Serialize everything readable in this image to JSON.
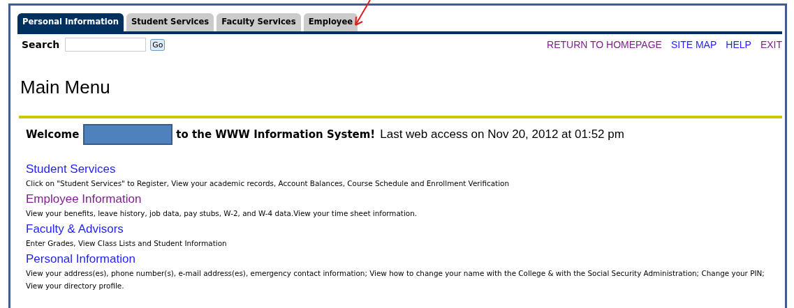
{
  "tabs": [
    {
      "label": "Personal Information",
      "selected": true
    },
    {
      "label": "Student Services",
      "selected": false
    },
    {
      "label": "Faculty Services",
      "selected": false
    },
    {
      "label": "Employee",
      "selected": false
    }
  ],
  "search": {
    "label": "Search",
    "button": "Go"
  },
  "top_links": [
    {
      "label": "RETURN TO HOMEPAGE",
      "visited": true
    },
    {
      "label": "SITE MAP",
      "visited": false
    },
    {
      "label": "HELP",
      "visited": false
    },
    {
      "label": "EXIT",
      "visited": true
    }
  ],
  "title": "Main Menu",
  "welcome": {
    "greeting": "Welcome",
    "message": "to the WWW Information System!",
    "last_access": "Last web access on Nov 20, 2012 at 01:52 pm"
  },
  "menu": [
    {
      "label": "Student Services",
      "visited": false,
      "description": "Click on \"Student Services\" to Register, View your academic records, Account Balances, Course Schedule and Enrollment Verification"
    },
    {
      "label": "Employee Information",
      "visited": true,
      "description": "View your benefits, leave history, job data, pay stubs, W-2, and W-4 data.View your time sheet information."
    },
    {
      "label": "Faculty & Advisors",
      "visited": false,
      "description": "Enter Grades, View Class Lists and Student Information"
    },
    {
      "label": "Personal Information",
      "visited": false,
      "description": "View your address(es), phone number(s), e-mail address(es), emergency contact information; View how to change your name with the College & with the Social Security Administration; Change your PIN; View your directory profile."
    }
  ]
}
